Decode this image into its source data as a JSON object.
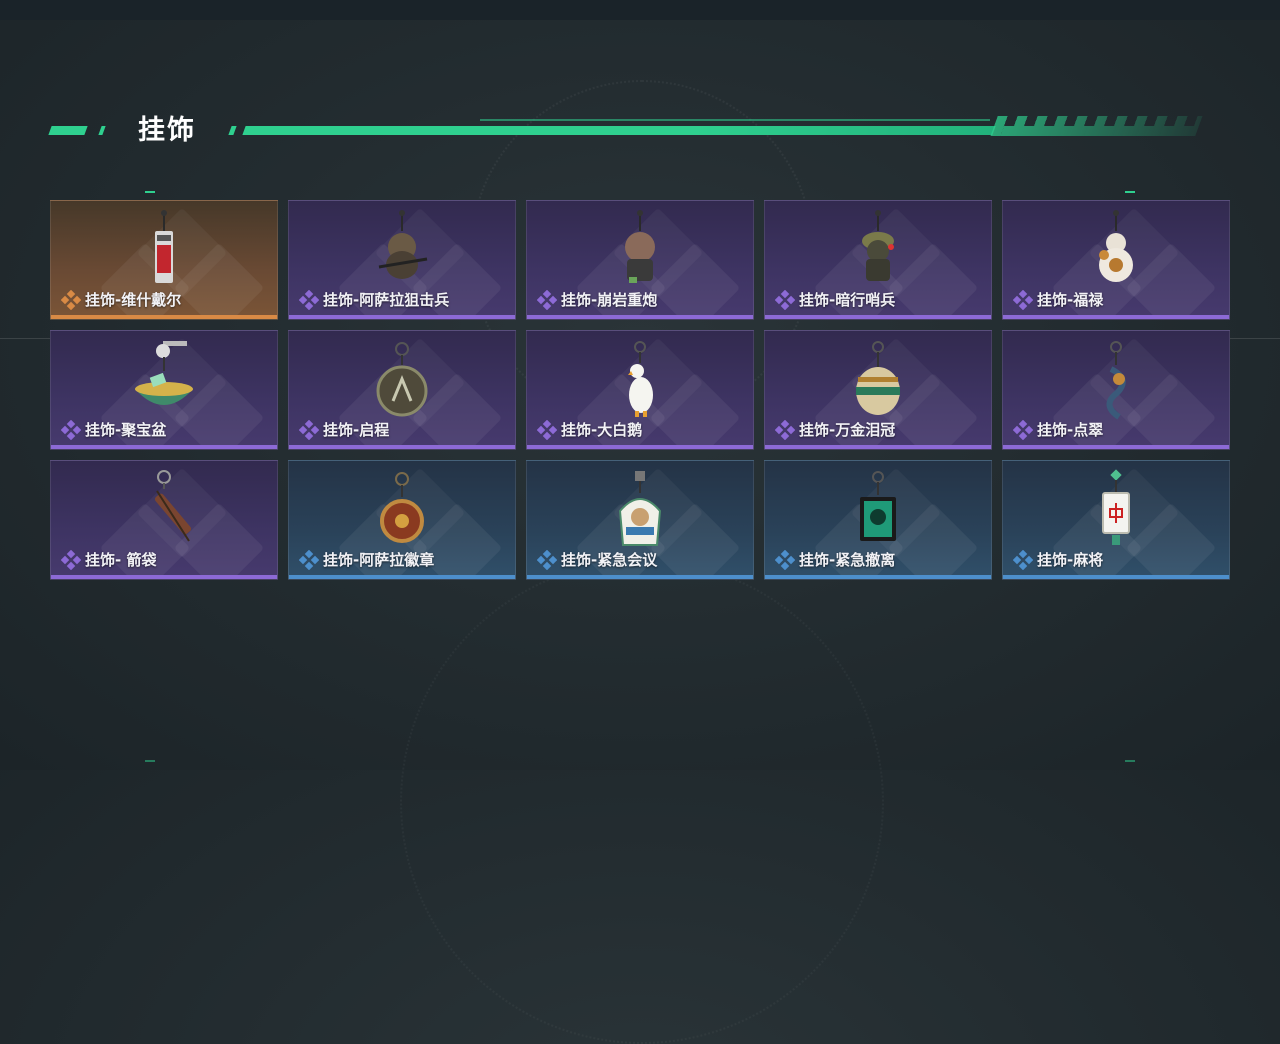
{
  "section": {
    "title": "挂饰"
  },
  "colors": {
    "accent": "#2fd08f",
    "rarity_purple": "#8d6ad6",
    "rarity_blue": "#4d8fcc",
    "rarity_orange": "#d98a45"
  },
  "items": [
    {
      "label": "挂饰-维什戴尔",
      "rarity": "orange",
      "icon": "vishdel-charm-icon"
    },
    {
      "label": "挂饰-阿萨拉狙击兵",
      "rarity": "purple",
      "icon": "sniper-charm-icon"
    },
    {
      "label": "挂饰-崩岩重炮",
      "rarity": "purple",
      "icon": "heavy-gunner-charm-icon"
    },
    {
      "label": "挂饰-暗行哨兵",
      "rarity": "purple",
      "icon": "sentry-charm-icon"
    },
    {
      "label": "挂饰-福禄",
      "rarity": "purple",
      "icon": "gourd-charm-icon"
    },
    {
      "label": "挂饰-聚宝盆",
      "rarity": "purple",
      "icon": "treasure-bowl-charm-icon"
    },
    {
      "label": "挂饰-启程",
      "rarity": "purple",
      "icon": "departure-ring-charm-icon"
    },
    {
      "label": "挂饰-大白鹅",
      "rarity": "purple",
      "icon": "goose-charm-icon"
    },
    {
      "label": "挂饰-万金泪冠",
      "rarity": "purple",
      "icon": "crown-charm-icon"
    },
    {
      "label": "挂饰-点翠",
      "rarity": "purple",
      "icon": "kingfisher-charm-icon"
    },
    {
      "label": "挂饰- 箭袋",
      "rarity": "purple",
      "icon": "quiver-charm-icon"
    },
    {
      "label": "挂饰-阿萨拉徽章",
      "rarity": "blue",
      "icon": "badge-charm-icon"
    },
    {
      "label": "挂饰-紧急会议",
      "rarity": "blue",
      "icon": "meeting-charm-icon"
    },
    {
      "label": "挂饰-紧急撤离",
      "rarity": "blue",
      "icon": "evacuation-charm-icon"
    },
    {
      "label": "挂饰-麻将",
      "rarity": "blue",
      "icon": "mahjong-charm-icon"
    }
  ]
}
